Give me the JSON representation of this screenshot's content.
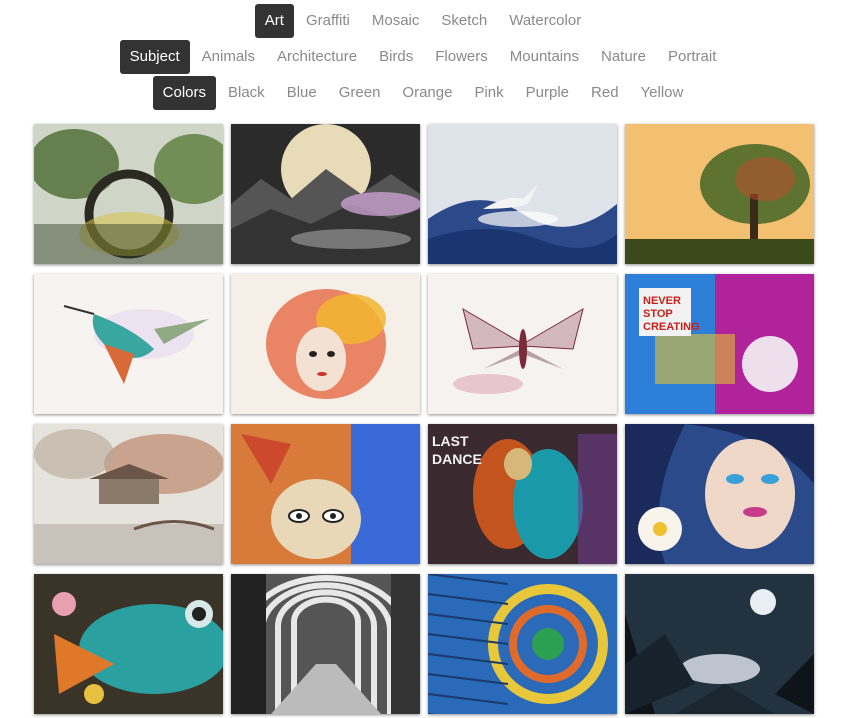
{
  "filters": {
    "category": {
      "items": [
        {
          "label": "Art",
          "active": true
        },
        {
          "label": "Graffiti",
          "active": false
        },
        {
          "label": "Mosaic",
          "active": false
        },
        {
          "label": "Sketch",
          "active": false
        },
        {
          "label": "Watercolor",
          "active": false
        }
      ]
    },
    "subject": {
      "items": [
        {
          "label": "Subject",
          "active": true
        },
        {
          "label": "Animals",
          "active": false
        },
        {
          "label": "Architecture",
          "active": false
        },
        {
          "label": "Birds",
          "active": false
        },
        {
          "label": "Flowers",
          "active": false
        },
        {
          "label": "Mountains",
          "active": false
        },
        {
          "label": "Nature",
          "active": false
        },
        {
          "label": "Portrait",
          "active": false
        }
      ]
    },
    "colors": {
      "items": [
        {
          "label": "Colors",
          "active": true
        },
        {
          "label": "Black",
          "active": false
        },
        {
          "label": "Blue",
          "active": false
        },
        {
          "label": "Green",
          "active": false
        },
        {
          "label": "Orange",
          "active": false
        },
        {
          "label": "Pink",
          "active": false
        },
        {
          "label": "Purple",
          "active": false
        },
        {
          "label": "Red",
          "active": false
        },
        {
          "label": "Yellow",
          "active": false
        }
      ]
    }
  },
  "gallery": {
    "thumbnails": [
      {
        "subject": "watercolor-bridge",
        "colors": [
          "#3f5a2a",
          "#d8c24a",
          "#a8b8c8"
        ]
      },
      {
        "subject": "moon-over-mountains",
        "colors": [
          "#2b2b2b",
          "#e8dcb8",
          "#c9a0d0"
        ]
      },
      {
        "subject": "seabird-over-waves",
        "colors": [
          "#2c4a8a",
          "#dde2ea",
          "#8a9ab0"
        ]
      },
      {
        "subject": "tree-silhouette-sunset",
        "colors": [
          "#e7a24a",
          "#4f6a2a",
          "#f3d27a"
        ]
      },
      {
        "subject": "hummingbird-watercolor",
        "colors": [
          "#f6f3f0",
          "#3aa6a0",
          "#d86a3a"
        ]
      },
      {
        "subject": "masked-woman-flowers",
        "colors": [
          "#f5efe8",
          "#e4572e",
          "#f2b630"
        ]
      },
      {
        "subject": "moth-sketch",
        "colors": [
          "#f7f2f2",
          "#7a2a3a",
          "#d89aa8"
        ]
      },
      {
        "subject": "never-stop-creating-graffiti",
        "colors": [
          "#b0239a",
          "#2d7fd8",
          "#e8e8e8"
        ],
        "text": "NEVER STOP CREATING"
      },
      {
        "subject": "japanese-garden-sketch",
        "colors": [
          "#e6e2dc",
          "#6a5548",
          "#b87a5a"
        ]
      },
      {
        "subject": "graffiti-woman-face",
        "colors": [
          "#f2a22a",
          "#3a6ad8",
          "#c8342a"
        ]
      },
      {
        "subject": "dancing-couple-mural",
        "colors": [
          "#c4541e",
          "#1a9aa8",
          "#d8b87a"
        ],
        "text": "LAST DANCE"
      },
      {
        "subject": "woman-with-flower-mural",
        "colors": [
          "#1a2a5a",
          "#f0d8c8",
          "#c83a8a"
        ]
      },
      {
        "subject": "fish-mosaic",
        "colors": [
          "#3a3328",
          "#2aa0a0",
          "#e0782a"
        ]
      },
      {
        "subject": "arched-corridor",
        "colors": [
          "#2a2a2a",
          "#a8a8a8",
          "#e8e8e8"
        ]
      },
      {
        "subject": "spiral-mosaic",
        "colors": [
          "#1a5aa8",
          "#2aa050",
          "#e8c83a"
        ]
      },
      {
        "subject": "moonlit-night",
        "colors": [
          "#1a2a3a",
          "#6a8aa8",
          "#e8eef4"
        ]
      }
    ]
  }
}
